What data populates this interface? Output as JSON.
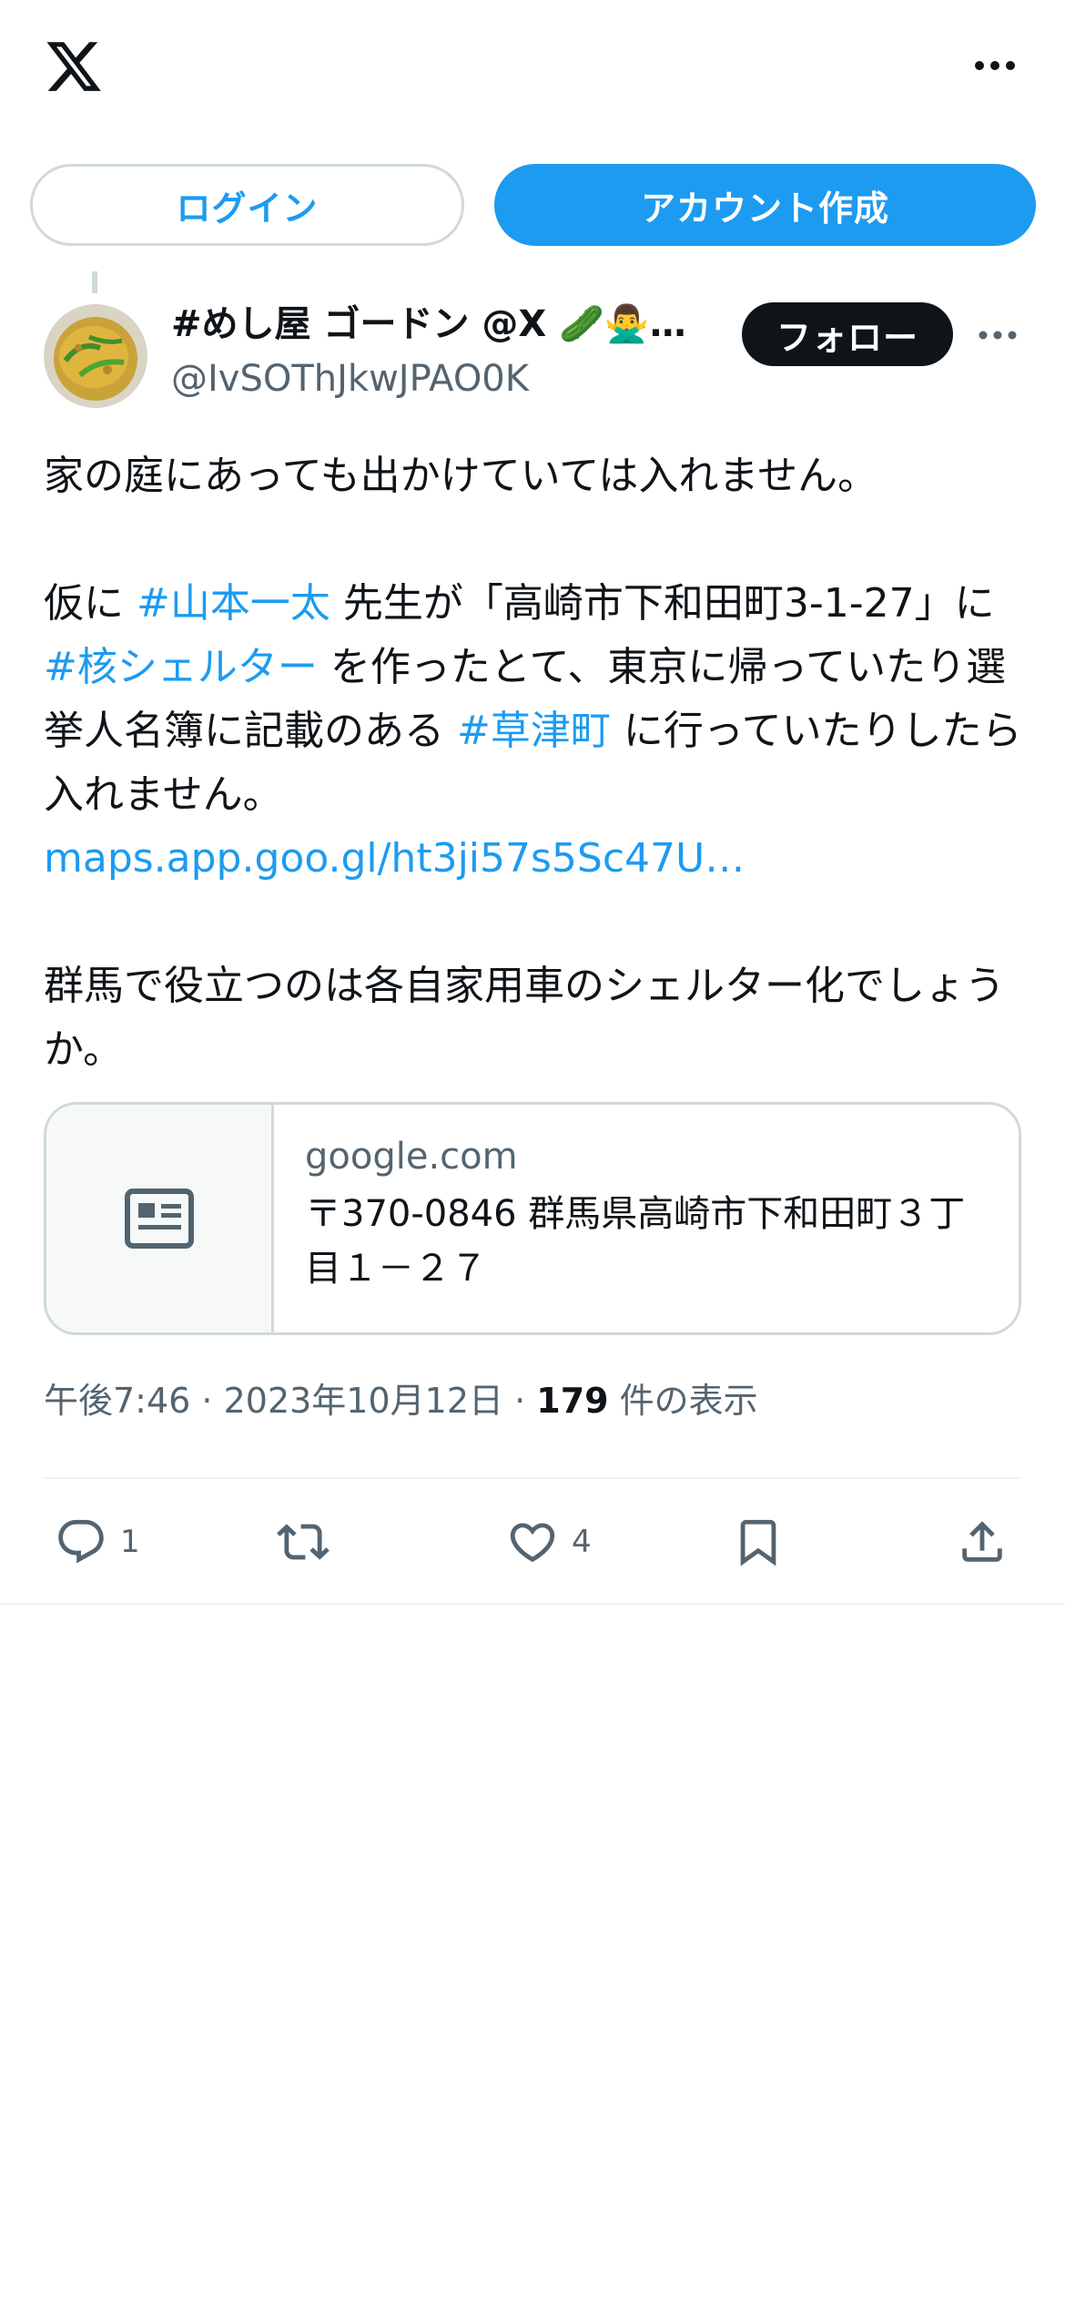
{
  "header": {
    "logo_icon": "x-logo-icon",
    "more_icon": "more-horizontal-icon"
  },
  "auth": {
    "login_label": "ログイン",
    "signup_label": "アカウント作成"
  },
  "tweet": {
    "author": {
      "display_name": "#めし屋 ゴードン @X 🥒🙅‍♂️…",
      "handle": "@IvSOThJkwJPAO0K",
      "avatar_icon": "avatar-image"
    },
    "follow_label": "フォロー",
    "more_icon": "more-horizontal-icon",
    "text": {
      "p1": "家の庭にあっても出かけていては入れません。",
      "p2_a": "仮に ",
      "p2_tag1": "#山本一太",
      "p2_b": " 先生が「高崎市下和田町3-1-27」に ",
      "p2_tag2": "#核シェルター",
      "p2_c": " を作ったとて、東京に帰っていたり選挙人名簿に記載のある ",
      "p2_tag3": "#草津町",
      "p2_d": " に行っていたりしたら入れません。",
      "p2_link": "maps.app.goo.gl/ht3ji57s5Sc47U…",
      "p3": "群馬で役立つのは各自家用車のシェルター化でしょうか。"
    },
    "card": {
      "domain": "google.com",
      "title": "〒370-0846 群馬県高崎市下和田町３丁目１－２７",
      "thumb_icon": "news-article-icon"
    },
    "meta": {
      "time": "午後7:46",
      "sep1": " · ",
      "date": "2023年10月12日",
      "sep2": " · ",
      "views": "179",
      "views_label": " 件の表示"
    },
    "actions": {
      "reply_count": "1",
      "retweet_count": "",
      "like_count": "4"
    }
  },
  "colors": {
    "accent": "#1d9bf0",
    "text": "#0f1419",
    "secondary": "#536471",
    "border": "#cfd9de"
  }
}
